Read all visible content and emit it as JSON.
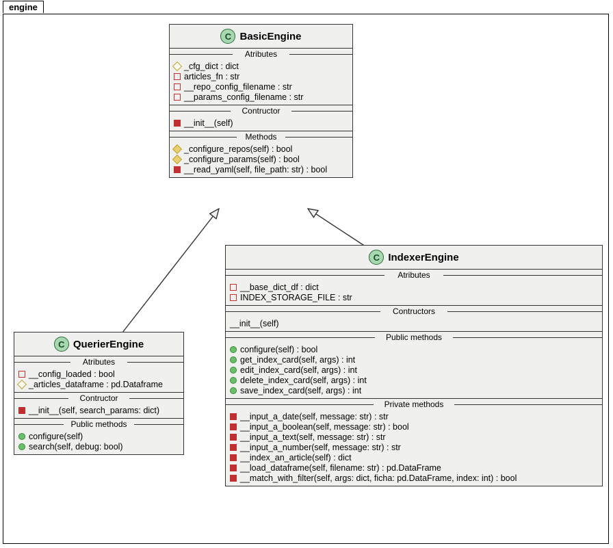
{
  "package": {
    "name": "engine"
  },
  "classes": {
    "basic": {
      "name": "BasicEngine",
      "sections": {
        "attr_label": "Atributes",
        "con_label": "Contructor",
        "met_label": "Methods"
      },
      "attrs": [
        "_cfg_dict : dict",
        "articles_fn : str",
        "__repo_config_filename : str",
        "__params_config_filename : str"
      ],
      "cons": [
        "__init__(self)"
      ],
      "methods": [
        "_configure_repos(self) : bool",
        "_configure_params(self) : bool",
        "__read_yaml(self, file_path: str) : bool"
      ]
    },
    "querier": {
      "name": "QuerierEngine",
      "sections": {
        "attr_label": "Atributes",
        "con_label": "Contructor",
        "pub_label": "Public methods"
      },
      "attrs": [
        "__config_loaded : bool",
        "_articles_dataframe : pd.Dataframe"
      ],
      "cons": [
        "__init__(self, search_params: dict)"
      ],
      "pubs": [
        "configure(self)",
        "search(self, debug: bool)"
      ]
    },
    "indexer": {
      "name": "IndexerEngine",
      "sections": {
        "attr_label": "Atributes",
        "con_label": "Contructors",
        "pub_label": "Public methods",
        "priv_label": "Private methods"
      },
      "attrs": [
        "__base_dict_df : dict",
        "INDEX_STORAGE_FILE : str"
      ],
      "cons": [
        "__init__(self)"
      ],
      "pubs": [
        "configure(self) : bool",
        "get_index_card(self, args) : int",
        "edit_index_card(self, args) : int",
        "delete_index_card(self, args) : int",
        "save_index_card(self, args) : int"
      ],
      "privs": [
        "__input_a_date(self, message: str) : str",
        "__input_a_boolean(self, message: str) : bool",
        "__input_a_text(self, message: str) : str",
        "__input_a_number(self, message: str) : str",
        "__index_an_article(self) : dict",
        "__load_dataframe(self, filename: str) : pd.DataFrame",
        "__match_with_filter(self, args: dict, ficha: pd.DataFrame, index: int) : bool"
      ]
    }
  }
}
